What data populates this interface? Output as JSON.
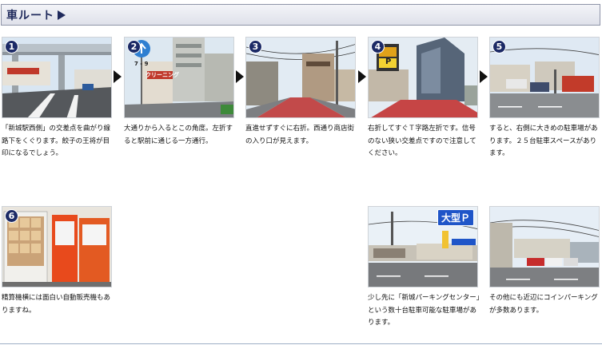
{
  "header": {
    "title": "車ルート"
  },
  "steps": [
    {
      "num": "1",
      "caption": "「新城駅西側」の交差点を曲がり線路下をくぐります。餃子の王将が目印になるでしょう。"
    },
    {
      "num": "2",
      "caption": "大通りから入るとこの角度。左折すると駅前に通じる一方通行。",
      "photo_text": {
        "road_sign": "7 - 9",
        "shop_sign": "クリーニング"
      }
    },
    {
      "num": "3",
      "caption": "直進せずすぐに右折。西通り商店街の入り口が見えます。"
    },
    {
      "num": "4",
      "caption": "右折してすぐＴ字路左折です。信号のない狭い交差点ですので注意してください。",
      "photo_text": {
        "parking_sign": "P"
      }
    },
    {
      "num": "5",
      "caption": "すると、右側に大きめの駐車場があります。２５台駐車スペースがあります。"
    },
    {
      "num": "6",
      "caption": "精算機横には面白い自動販売機もありますね。"
    },
    {
      "num": "",
      "caption": "少し先に「新城パーキングセンター」という数十台駐車可能な駐車場があります。",
      "photo_text": {
        "badge": "大型Ｐ"
      }
    },
    {
      "num": "",
      "caption": "その他にも近辺にコインパーキングが多数あります。"
    }
  ]
}
